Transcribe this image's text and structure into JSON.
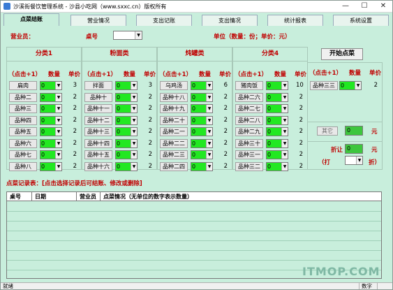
{
  "window": {
    "title": "沙溪街餐饮管理系统 - 沙县小吃网（www.sxxc.cn）版权所有",
    "minimize": "—",
    "maximize": "☐",
    "close": "✕"
  },
  "tabs": [
    "点菜结账",
    "营业情况",
    "支出记账",
    "支出情况",
    "统计报表",
    "系统设置"
  ],
  "top": {
    "revenue_label": "营业员：",
    "table_label": "桌号",
    "unit_note": "单位（数量：份；单价：元）"
  },
  "panels": [
    {
      "title": "分类1",
      "items": [
        "扁肉",
        "品种二",
        "品种三",
        "品种四",
        "品种五",
        "品种六",
        "品种七",
        "品种八"
      ],
      "prices": [
        "3",
        "2",
        "2",
        "2",
        "2",
        "2",
        "2",
        "2"
      ]
    },
    {
      "title": "粉面类",
      "items": [
        "拌面",
        "品种十",
        "品种十一",
        "品种十二",
        "品种十三",
        "品种十四",
        "品种十五",
        "品种十六"
      ],
      "prices": [
        "3",
        "2",
        "2",
        "2",
        "2",
        "2",
        "2",
        "2"
      ]
    },
    {
      "title": "炖罐类",
      "items": [
        "乌鸡汤",
        "品种十八",
        "品种十九",
        "品种二十",
        "品种二一",
        "品种二二",
        "品种二三",
        "品种二四"
      ],
      "prices": [
        "6",
        "2",
        "2",
        "2",
        "2",
        "2",
        "2",
        "2"
      ]
    },
    {
      "title": "分类4",
      "items": [
        "猪肉饭",
        "品种二六",
        "品种二七",
        "品种二八",
        "品种二九",
        "品种三十",
        "品种三一",
        "品种三二"
      ],
      "prices": [
        "10",
        "2",
        "2",
        "2",
        "2",
        "2",
        "2",
        "2"
      ]
    }
  ],
  "col_headers": {
    "click": "（点击+1）",
    "qty": "数量",
    "price": "单价"
  },
  "qty_value": "0",
  "start_button": "开始点菜",
  "extra_panel": {
    "item": "品种三三",
    "price": "2",
    "other_button": "其它",
    "other_value": "0",
    "yuan": "元",
    "discount_label": "折让",
    "discount_value": "0",
    "discount_yuan": "元",
    "da": "（打",
    "zhe": "折）"
  },
  "record_label": "点菜记录表：[点击选择记录后可结账、修改或删除]",
  "grid_headers": [
    "桌号",
    "日期",
    "营业员",
    "点菜情况（无单位的数字表示数量）"
  ],
  "status": {
    "left": "就绪",
    "mid": "数字"
  },
  "logo": "ITMOP.COM"
}
